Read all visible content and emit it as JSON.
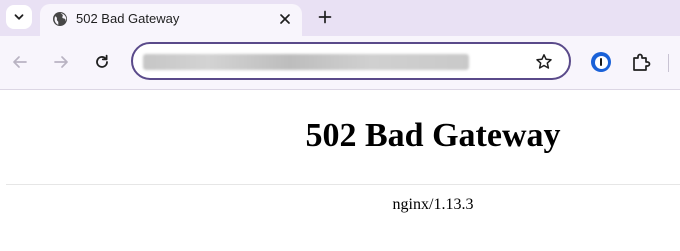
{
  "browser": {
    "tab": {
      "title": "502 Bad Gateway",
      "favicon": "globe-icon"
    },
    "toolbar": {
      "address_value_blurred": true
    },
    "colors": {
      "tabstrip_bg": "#e9e1f4",
      "toolbar_bg": "#f8f5fc",
      "omnibox_border": "#5a4a8a",
      "extension_accent": "#1a61d8"
    }
  },
  "page": {
    "heading": "502 Bad Gateway",
    "server": "nginx/1.13.3"
  }
}
